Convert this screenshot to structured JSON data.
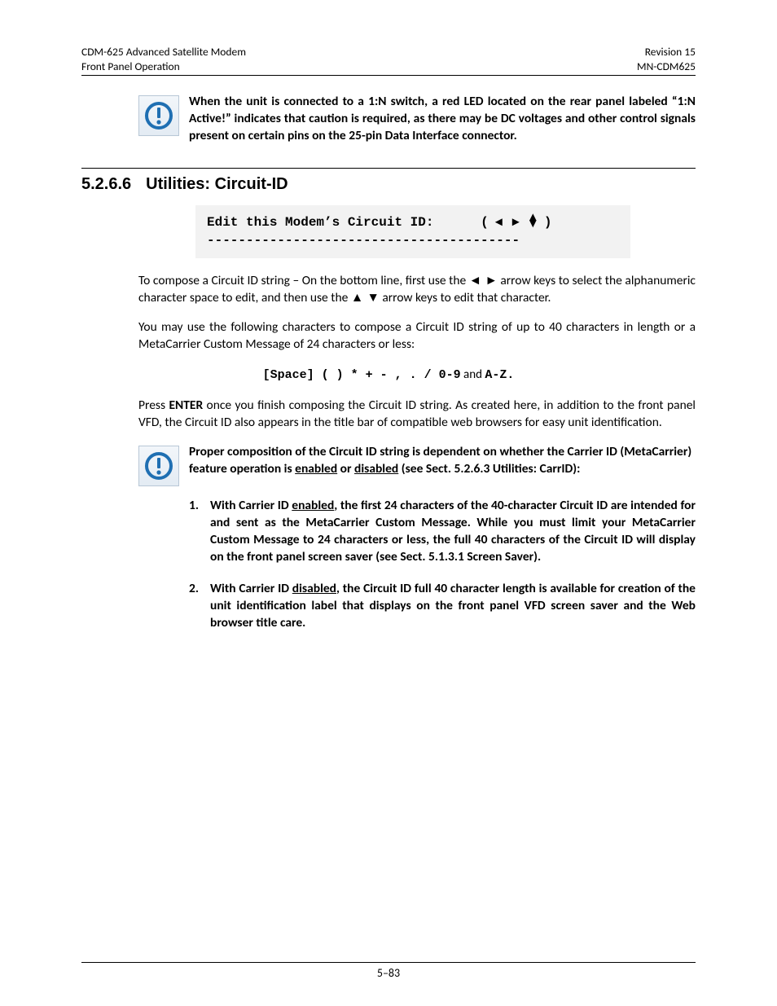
{
  "header": {
    "left_line1": "CDM-625 Advanced Satellite Modem",
    "left_line2": "Front Panel Operation",
    "right_line1": "Revision 15",
    "right_line2": "MN-CDM625"
  },
  "note1": {
    "text": "When the unit is connected to a 1:N switch, a red LED located on the rear panel labeled “1:N Active!” indicates that caution is required, as there may be DC voltages and other control signals present on certain pins on the 25-pin Data Interface connector."
  },
  "section": {
    "number": "5.2.6.6",
    "title": "Utilities: Circuit-ID"
  },
  "lcd": {
    "line1_text": "Edit this Modem’s Circuit ID:",
    "line1_suffix_open": "(",
    "line1_suffix_close": ")",
    "line2": "----------------------------------------"
  },
  "p1": {
    "pre": "To compose a Circuit ID string – On the bottom line, first use the ",
    "arrows1": "◄ ►",
    "mid": " arrow keys to select the alphanumeric character space to edit, and then use the ",
    "arrows2": "▲ ▼",
    "post": " arrow keys to edit that character."
  },
  "p2": "You may use the following characters to compose a Circuit ID string of up to 40 characters in length or a MetaCarrier Custom Message of 24 characters or less:",
  "chars_mono": "[Space] ( ) * + - , . / 0-9",
  "chars_tail": " and ",
  "chars_tail2": "A-Z",
  "chars_tail3": ".",
  "p3_pre": "Press ",
  "p3_enter": "ENTER",
  "p3_post": " once you finish composing the Circuit ID string. As created here, in addition to the front panel VFD, the Circuit ID also appears in the title bar of compatible web browsers for easy unit identification.",
  "note2": {
    "lead": "Proper composition of the Circuit ID string is dependent on whether the Carrier ID (MetaCarrier) feature operation is ",
    "enabled": "enabled",
    "or": " or ",
    "disabled": "disabled",
    "tail": " (see Sect. 5.2.6.3 Utilities: CarrID):"
  },
  "list": [
    {
      "n": "1.",
      "pre": "With Carrier ID ",
      "u": "enabled",
      "post": ", the first 24 characters of the 40-character Circuit ID are intended for and sent as the MetaCarrier Custom Message. While you must limit your MetaCarrier Custom Message to 24 characters or less, the full 40 characters of the Circuit ID will display on the front panel screen saver (see Sect. 5.1.3.1 Screen Saver)."
    },
    {
      "n": "2.",
      "pre": "With Carrier ID ",
      "u": "disabled",
      "post": ", the Circuit ID full 40 character length is available for creation of the unit identification label that displays on the front panel VFD screen saver and the Web browser title care."
    }
  ],
  "footer": "5–83"
}
